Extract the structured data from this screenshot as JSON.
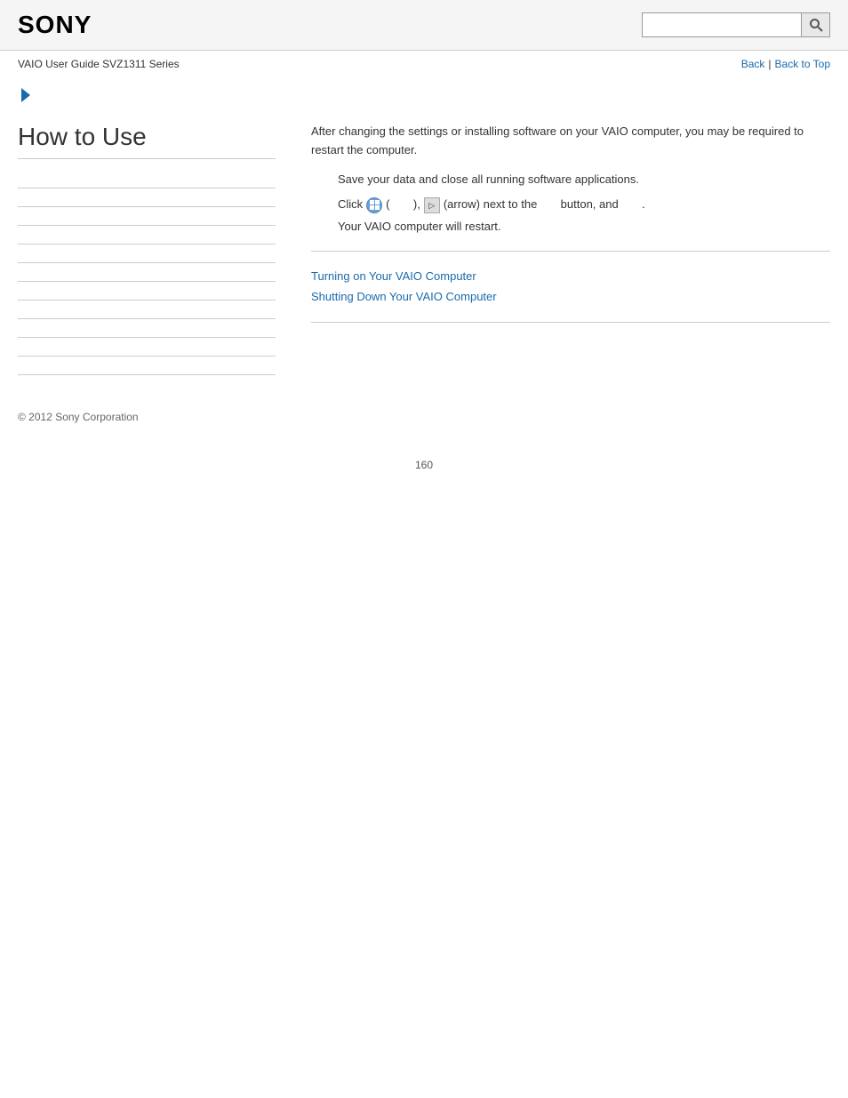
{
  "header": {
    "logo": "SONY",
    "search_placeholder": "",
    "search_icon": "search-icon"
  },
  "sub_header": {
    "guide_title": "VAIO User Guide SVZ1311 Series",
    "back_label": "Back",
    "back_to_top_label": "Back to Top"
  },
  "breadcrumb": {
    "chevron_icon": "chevron-right-icon"
  },
  "sidebar": {
    "title": "How to Use",
    "items": [
      {
        "label": ""
      },
      {
        "label": ""
      },
      {
        "label": ""
      },
      {
        "label": ""
      },
      {
        "label": ""
      },
      {
        "label": ""
      },
      {
        "label": ""
      },
      {
        "label": ""
      },
      {
        "label": ""
      },
      {
        "label": ""
      },
      {
        "label": ""
      }
    ]
  },
  "content": {
    "intro": "After changing the settings or installing software on your VAIO computer, you may be required to restart the computer.",
    "step1": "Save your data and close all running software applications.",
    "step2_prefix": "Click",
    "step2_paren_open": "(",
    "step2_paren_close": "),",
    "step2_arrow_label": "▷",
    "step2_middle": "(arrow) next to the",
    "step2_button_label": "button, and",
    "step2_end": ".",
    "step3": "Your VAIO computer will restart.",
    "link1": "Turning on Your VAIO Computer",
    "link2": "Shutting Down Your VAIO Computer"
  },
  "footer": {
    "copyright": "© 2012 Sony Corporation"
  },
  "page_number": "160"
}
